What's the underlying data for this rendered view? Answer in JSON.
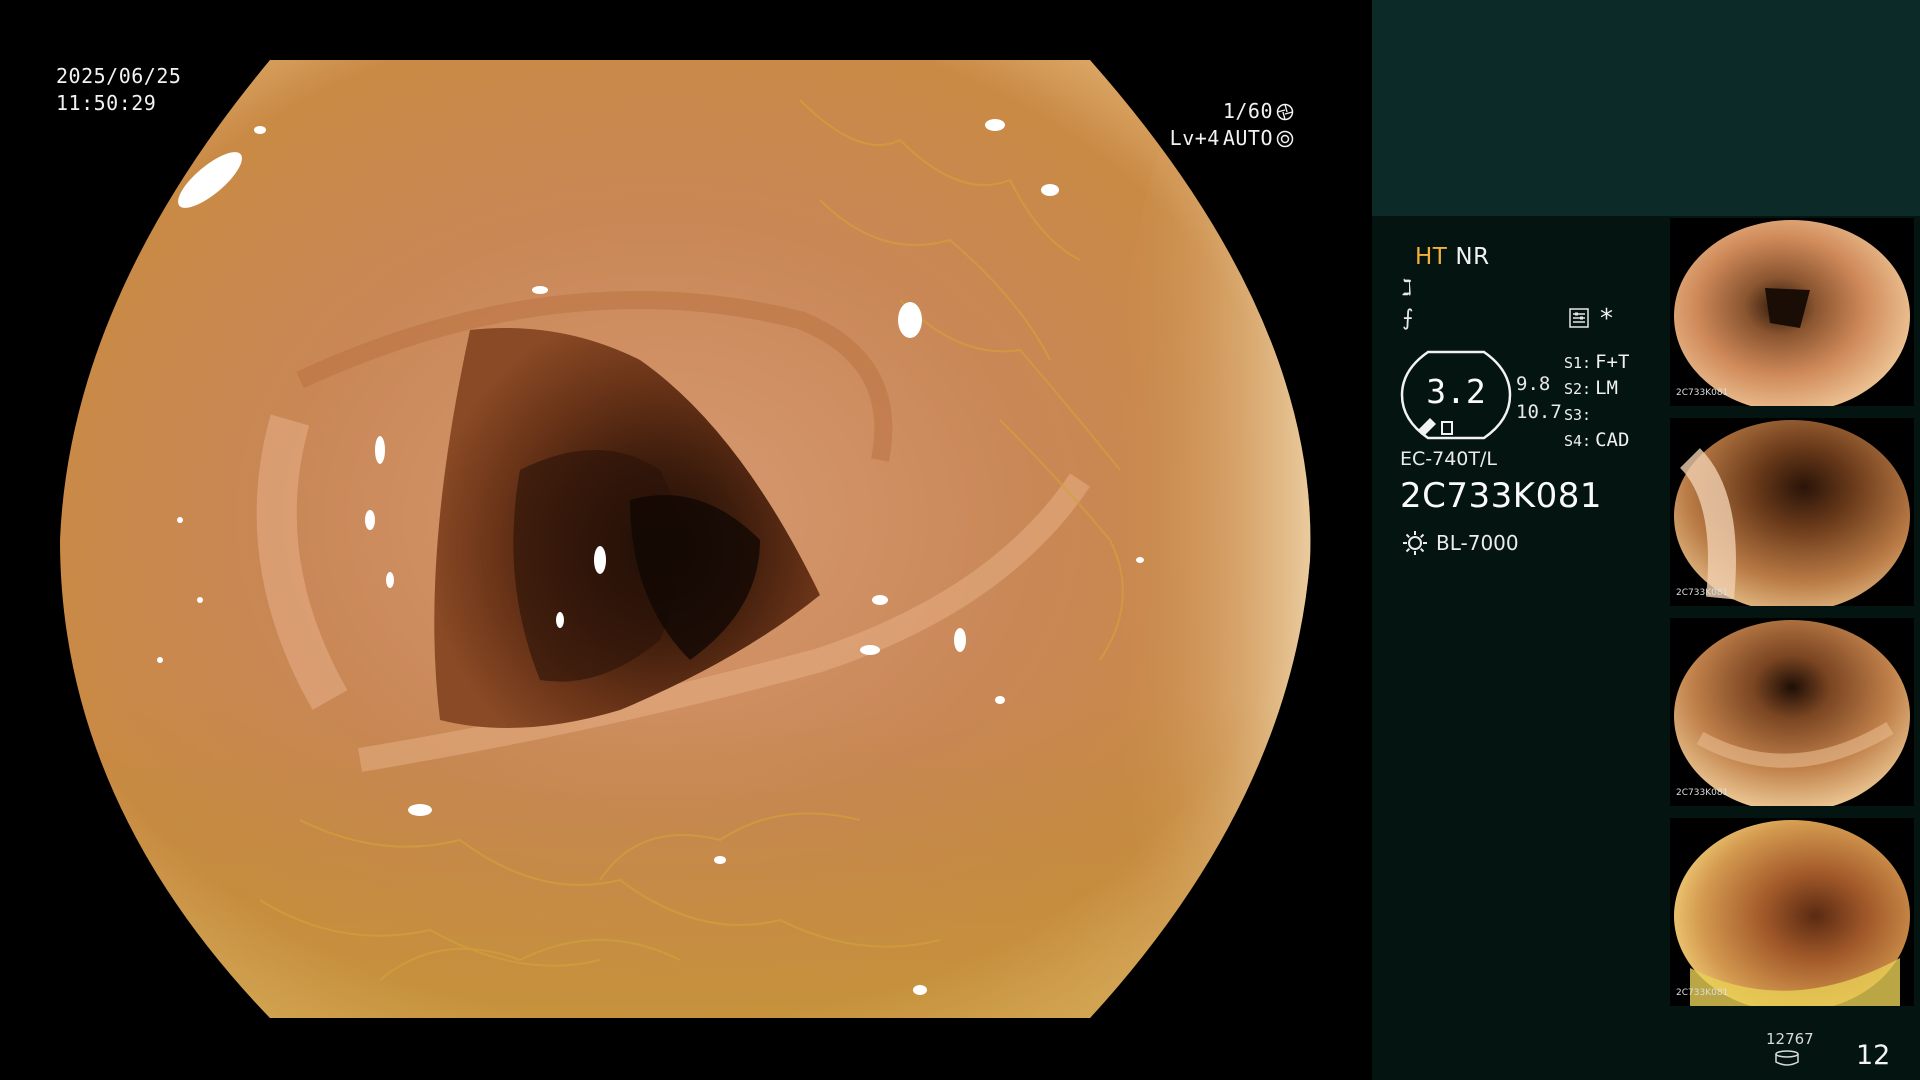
{
  "osd": {
    "date": "2025/06/25",
    "time": "11:50:29",
    "shutter": "1/60",
    "level": "Lv+4",
    "iris": "AUTO"
  },
  "info": {
    "mode_ht": "HT",
    "mode_nr": "NR",
    "sym_a": "ℷ",
    "sym_b": "⨍",
    "star": "*",
    "enhancement": "3.2",
    "side_value_1": "9.8",
    "side_value_2": "10.7",
    "switches": [
      {
        "key": "S1:",
        "value": "F+T"
      },
      {
        "key": "S2:",
        "value": "LM"
      },
      {
        "key": "S3:",
        "value": ""
      },
      {
        "key": "S4:",
        "value": "CAD"
      }
    ],
    "scope_model": "EC-740T/L",
    "scope_serial": "2C733K081",
    "light_source": "BL-7000"
  },
  "thumbnails": [
    {
      "label": "2C733K081"
    },
    {
      "label": "2C733K081"
    },
    {
      "label": "2C733K081"
    },
    {
      "label": "2C733K081"
    }
  ],
  "footer": {
    "image_count": "12767",
    "page_number": "12"
  },
  "colors": {
    "panel_bg": "#031411",
    "panel_top": "#0c2b28",
    "ht_accent": "#f2b13b"
  }
}
